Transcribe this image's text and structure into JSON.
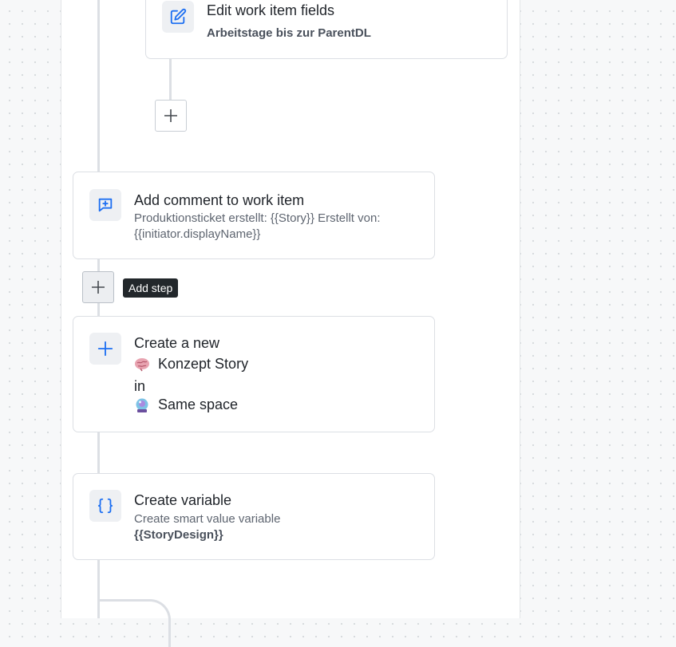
{
  "colors": {
    "accent": "#1d6ff2",
    "tooltip_bg": "#22272b"
  },
  "steps": {
    "edit_fields": {
      "icon": "edit-icon",
      "title": "Edit work item fields",
      "detail": "Arbeitstage bis zur ParentDL"
    },
    "add_comment": {
      "icon": "comment-add-icon",
      "title": "Add comment to work item",
      "detail_line1": "Produktionsticket erstellt: {{Story}} Erstellt von:",
      "detail_line2": "{{initiator.displayName}}"
    },
    "create_item": {
      "icon": "plus-icon",
      "title": "Create a new",
      "item_type_icon": "brain-emoji",
      "item_type": "Konzept Story",
      "in_label": "in",
      "space_icon": "crystal-ball-emoji",
      "space": "Same space"
    },
    "create_variable": {
      "icon": "braces-icon",
      "title": "Create variable",
      "detail": "Create smart value variable",
      "variable": "{{StoryDesign}}"
    }
  },
  "tooltip": {
    "label": "Add step"
  }
}
